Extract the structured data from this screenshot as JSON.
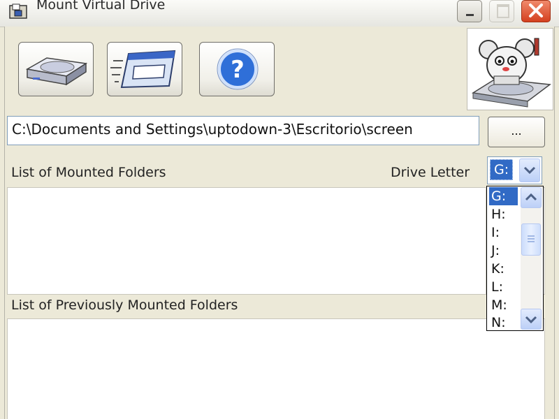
{
  "window": {
    "title": "Mount Virtual Drive"
  },
  "toolbar": {
    "buttons": [
      {
        "name": "mount-drive-button",
        "icon": "hard-drive-icon"
      },
      {
        "name": "open-folder-window-button",
        "icon": "window-icon"
      },
      {
        "name": "help-button",
        "icon": "question-mark-icon"
      }
    ]
  },
  "logo": {
    "icon": "drive-mascot-logo"
  },
  "path_field": {
    "value": "C:\\Documents and Settings\\uptodown-3\\Escritorio\\screen"
  },
  "browse_button": {
    "label": "..."
  },
  "mounted": {
    "header": "List of Mounted Folders"
  },
  "drive_letter": {
    "label": "Drive Letter",
    "selected": "G:",
    "options": [
      "G:",
      "H:",
      "I:",
      "J:",
      "K:",
      "L:",
      "M:",
      "N:"
    ]
  },
  "previous": {
    "header": "List of Previously Mounted Folders"
  },
  "colors": {
    "selection": "#316ac5",
    "close_button": "#d4401f",
    "face": "#ece9d8"
  }
}
